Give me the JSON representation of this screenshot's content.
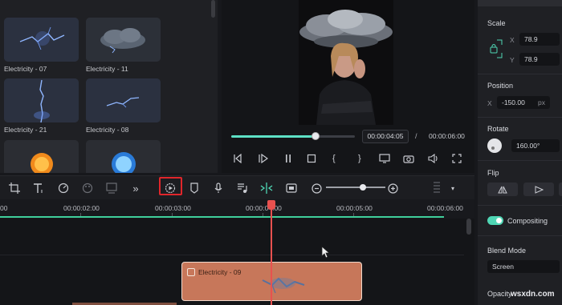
{
  "assets": {
    "items": [
      {
        "label": "Electricity - 07",
        "icon": "lightning-effect-icon"
      },
      {
        "label": "Electricity - 11",
        "icon": "storm-cloud-effect-icon"
      },
      {
        "label": "Electricity - 21",
        "icon": "vertical-bolt-effect-icon"
      },
      {
        "label": "Electricity - 08",
        "icon": "arc-effect-icon"
      },
      {
        "label": "",
        "icon": "sun-effect-icon"
      },
      {
        "label": "",
        "icon": "plasma-orb-effect-icon"
      }
    ]
  },
  "preview": {
    "current_time": "00:00:04:05",
    "separator": "/",
    "total_time": "00:00:06:00",
    "progress": 0.68,
    "controls": [
      "prev-frame-icon",
      "play-slow-icon",
      "pause-icon",
      "stop-icon",
      "mark-in-icon",
      "mark-out-icon",
      "display-icon",
      "snapshot-icon",
      "volume-icon",
      "fullscreen-icon"
    ]
  },
  "inspector": {
    "scale": {
      "label": "Scale",
      "x_label": "X",
      "x_value": "78.9",
      "y_label": "Y",
      "y_value": "78.9"
    },
    "position": {
      "label": "Position",
      "x_label": "X",
      "x_value": "-150.00",
      "x_unit": "px"
    },
    "rotate": {
      "label": "Rotate",
      "value": "160.00°"
    },
    "flip": {
      "label": "Flip"
    },
    "compositing": {
      "label": "Compositing",
      "enabled": true
    },
    "blend_mode": {
      "label": "Blend Mode",
      "value": "Screen"
    },
    "opacity": {
      "label": "Opacity"
    }
  },
  "toolbar": {
    "tools": [
      "crop-icon",
      "text-icon",
      "speed-icon",
      "color-icon",
      "ai-portrait-icon",
      "more-icon",
      "render-preview-icon",
      "marker-icon",
      "mic-icon",
      "audio-edit-icon",
      "split-icon",
      "fit-icon",
      "zoom-out-icon",
      "zoom-in-icon",
      "grid-icon",
      "dropdown-icon"
    ],
    "zoom_level": 0.62,
    "highlight_color": "#e0262b"
  },
  "timeline": {
    "ruler": [
      "00",
      "00:00:02:00",
      "00:00:03:00",
      "00:00:04:00",
      "00:00:05:00",
      "00:00:06:00"
    ],
    "clip": {
      "label": "Electricity - 09",
      "color": "#c7775a"
    },
    "playhead_color": "#e8514f",
    "accent": "#3fcf9b"
  },
  "watermark": "wsxdn.com"
}
